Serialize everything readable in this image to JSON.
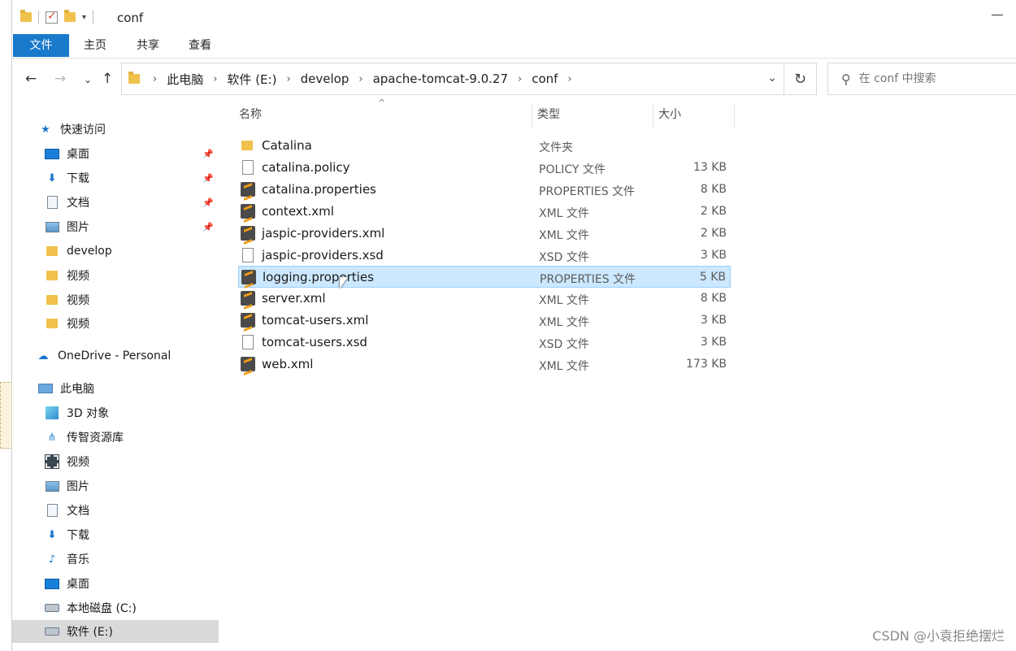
{
  "window": {
    "title": "conf"
  },
  "ribbon": {
    "tabs": [
      "文件",
      "主页",
      "共享",
      "查看"
    ]
  },
  "address": {
    "crumbs": [
      "此电脑",
      "软件 (E:)",
      "develop",
      "apache-tomcat-9.0.27",
      "conf"
    ]
  },
  "search": {
    "placeholder": "在 conf 中搜索"
  },
  "navpane": {
    "quick_access": "快速访问",
    "items": [
      {
        "label": "桌面",
        "icon": "desktop-icon",
        "pinned": true
      },
      {
        "label": "下载",
        "icon": "download-icon",
        "pinned": true
      },
      {
        "label": "文档",
        "icon": "document-icon",
        "pinned": true
      },
      {
        "label": "图片",
        "icon": "pictures-icon",
        "pinned": true
      },
      {
        "label": "develop",
        "icon": "folder-icon"
      },
      {
        "label": "视频",
        "icon": "folder-icon"
      },
      {
        "label": "视频",
        "icon": "folder-icon"
      },
      {
        "label": "视频",
        "icon": "folder-icon"
      }
    ],
    "onedrive": "OneDrive - Personal",
    "this_pc": "此电脑",
    "pc_items": [
      {
        "label": "3D 对象",
        "icon": "3d-objects-icon"
      },
      {
        "label": "传智资源库",
        "icon": "share-icon"
      },
      {
        "label": "视频",
        "icon": "video-icon"
      },
      {
        "label": "图片",
        "icon": "pictures-icon"
      },
      {
        "label": "文档",
        "icon": "document-icon"
      },
      {
        "label": "下载",
        "icon": "download-icon"
      },
      {
        "label": "音乐",
        "icon": "music-icon"
      },
      {
        "label": "桌面",
        "icon": "desktop-icon"
      },
      {
        "label": "本地磁盘 (C:)",
        "icon": "drive-icon"
      },
      {
        "label": "软件 (E:)",
        "icon": "drive-icon",
        "selected": true
      }
    ]
  },
  "columns": {
    "name": "名称",
    "type": "类型",
    "size": "大小"
  },
  "files": [
    {
      "name": "Catalina",
      "type": "文件夹",
      "size": "",
      "icon": "folder"
    },
    {
      "name": "catalina.policy",
      "type": "POLICY 文件",
      "size": "13 KB",
      "icon": "blank"
    },
    {
      "name": "catalina.properties",
      "type": "PROPERTIES 文件",
      "size": "8 KB",
      "icon": "sublime"
    },
    {
      "name": "context.xml",
      "type": "XML 文件",
      "size": "2 KB",
      "icon": "sublime"
    },
    {
      "name": "jaspic-providers.xml",
      "type": "XML 文件",
      "size": "2 KB",
      "icon": "sublime"
    },
    {
      "name": "jaspic-providers.xsd",
      "type": "XSD 文件",
      "size": "3 KB",
      "icon": "blank"
    },
    {
      "name": "logging.properties",
      "type": "PROPERTIES 文件",
      "size": "5 KB",
      "icon": "sublime",
      "selected": true
    },
    {
      "name": "server.xml",
      "type": "XML 文件",
      "size": "8 KB",
      "icon": "sublime"
    },
    {
      "name": "tomcat-users.xml",
      "type": "XML 文件",
      "size": "3 KB",
      "icon": "sublime"
    },
    {
      "name": "tomcat-users.xsd",
      "type": "XSD 文件",
      "size": "3 KB",
      "icon": "blank"
    },
    {
      "name": "web.xml",
      "type": "XML 文件",
      "size": "173 KB",
      "icon": "sublime"
    }
  ],
  "watermark": "CSDN @小袁拒绝摆烂",
  "colors": {
    "accent": "#1979ca",
    "selection": "#cce8ff",
    "selection_border": "#99d1ff",
    "nav_selected": "#d9d9d9"
  }
}
